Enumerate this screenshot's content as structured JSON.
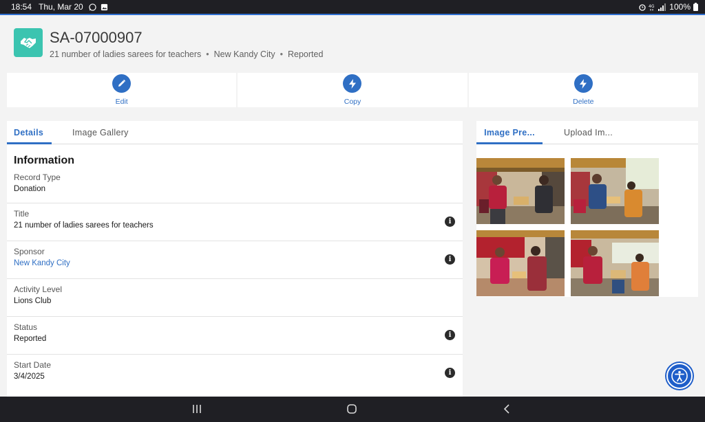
{
  "status_bar": {
    "time": "18:54",
    "date": "Thu, Mar 20",
    "battery": "100%",
    "icons": [
      "whatsapp-icon",
      "gallery-icon",
      "alarm-icon",
      "lte-icon",
      "signal-icon",
      "battery-icon"
    ]
  },
  "record": {
    "number": "SA-07000907",
    "subtitle_title": "21 number of ladies sarees for teachers",
    "subtitle_sponsor": "New Kandy City",
    "subtitle_status": "Reported",
    "separator": "•",
    "icon": "handshake-icon"
  },
  "actions": [
    {
      "label": "Edit",
      "icon": "pencil-icon"
    },
    {
      "label": "Copy",
      "icon": "lightning-icon"
    },
    {
      "label": "Delete",
      "icon": "lightning-icon"
    }
  ],
  "left_tabs": [
    {
      "label": "Details",
      "active": true
    },
    {
      "label": "Image Gallery",
      "active": false
    }
  ],
  "section_title": "Information",
  "fields": [
    {
      "label": "Record Type",
      "value": "Donation",
      "link": false,
      "info": false
    },
    {
      "label": "Title",
      "value": "21 number of ladies sarees for teachers",
      "link": false,
      "info": true
    },
    {
      "label": "Sponsor",
      "value": "New Kandy City",
      "link": true,
      "info": true
    },
    {
      "label": "Activity Level",
      "value": "Lions Club",
      "link": false,
      "info": false
    },
    {
      "label": "Status",
      "value": "Reported",
      "link": false,
      "info": true
    },
    {
      "label": "Start Date",
      "value": "3/4/2025",
      "link": false,
      "info": true
    }
  ],
  "right_tabs": [
    {
      "label": "Image Pre...",
      "active": true
    },
    {
      "label": "Upload Im...",
      "active": false
    }
  ],
  "colors": {
    "accent": "#2f6fc4",
    "record_icon": "#3bc4b0",
    "accessibility": "#1f5ec9"
  }
}
